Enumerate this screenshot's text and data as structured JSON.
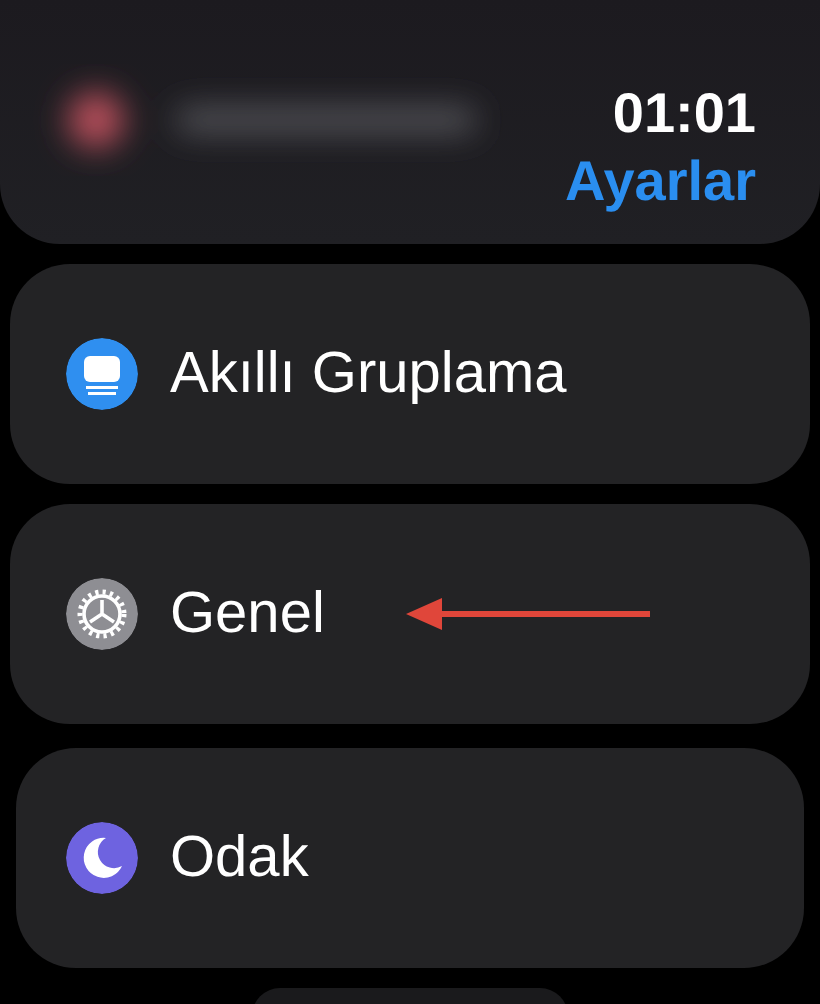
{
  "header": {
    "time": "01:01",
    "title": "Ayarlar"
  },
  "items": [
    {
      "label": "Akıllı Gruplama",
      "color": "#2f8ff0",
      "annotated": false
    },
    {
      "label": "Genel",
      "color": "#8e8e93",
      "annotated": true
    },
    {
      "label": "Odak",
      "color": "#6e63e0",
      "annotated": false
    }
  ]
}
